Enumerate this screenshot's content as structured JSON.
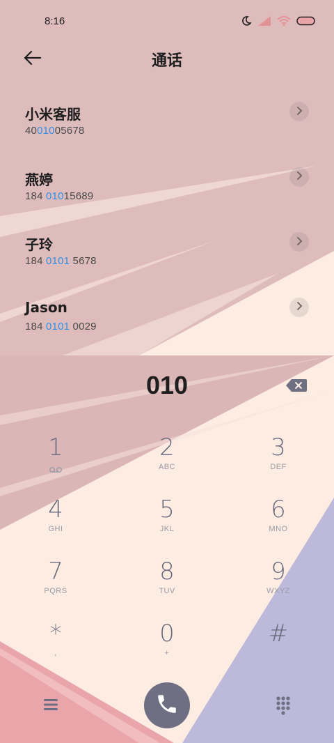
{
  "status_bar": {
    "time": "8:16",
    "icons": [
      "moon-icon",
      "signal-icon",
      "wifi-icon",
      "battery-icon"
    ]
  },
  "header": {
    "title": "通话",
    "back_icon": "back-arrow-icon"
  },
  "contacts": [
    {
      "name": "小米客服",
      "number_pre": "40",
      "number_match": "010",
      "number_post": "05678"
    },
    {
      "name": "燕婷",
      "number_pre": "184 ",
      "number_match": "010",
      "number_post": "15689"
    },
    {
      "name": "子玲",
      "number_pre": "184 ",
      "number_match": "0101",
      "number_post": " 5678"
    },
    {
      "name": "Jason",
      "number_pre": "184 ",
      "number_match": "0101",
      "number_post": " 0029"
    }
  ],
  "dialer": {
    "input": "010",
    "backspace_icon": "backspace-icon"
  },
  "keypad": [
    {
      "digit": "1",
      "letters": ""
    },
    {
      "digit": "2",
      "letters": "ABC"
    },
    {
      "digit": "3",
      "letters": "DEF"
    },
    {
      "digit": "4",
      "letters": "GHI"
    },
    {
      "digit": "5",
      "letters": "JKL"
    },
    {
      "digit": "6",
      "letters": "MNO"
    },
    {
      "digit": "7",
      "letters": "PQRS"
    },
    {
      "digit": "8",
      "letters": "TUV"
    },
    {
      "digit": "9",
      "letters": "WXYZ"
    },
    {
      "digit": "*",
      "letters": ","
    },
    {
      "digit": "0",
      "letters": "+"
    },
    {
      "digit": "#",
      "letters": ""
    }
  ],
  "bottom_bar": {
    "menu_icon": "menu-icon",
    "call_icon": "phone-icon",
    "keypad_icon": "dialpad-icon"
  },
  "colors": {
    "highlight": "#2f8fe6",
    "call_button": "#6e6f82",
    "bg_pink": "#dfbcbc",
    "bg_cream": "#fdece2",
    "bg_lavender": "#bdb9da",
    "bg_rose": "#e9a5a9"
  }
}
